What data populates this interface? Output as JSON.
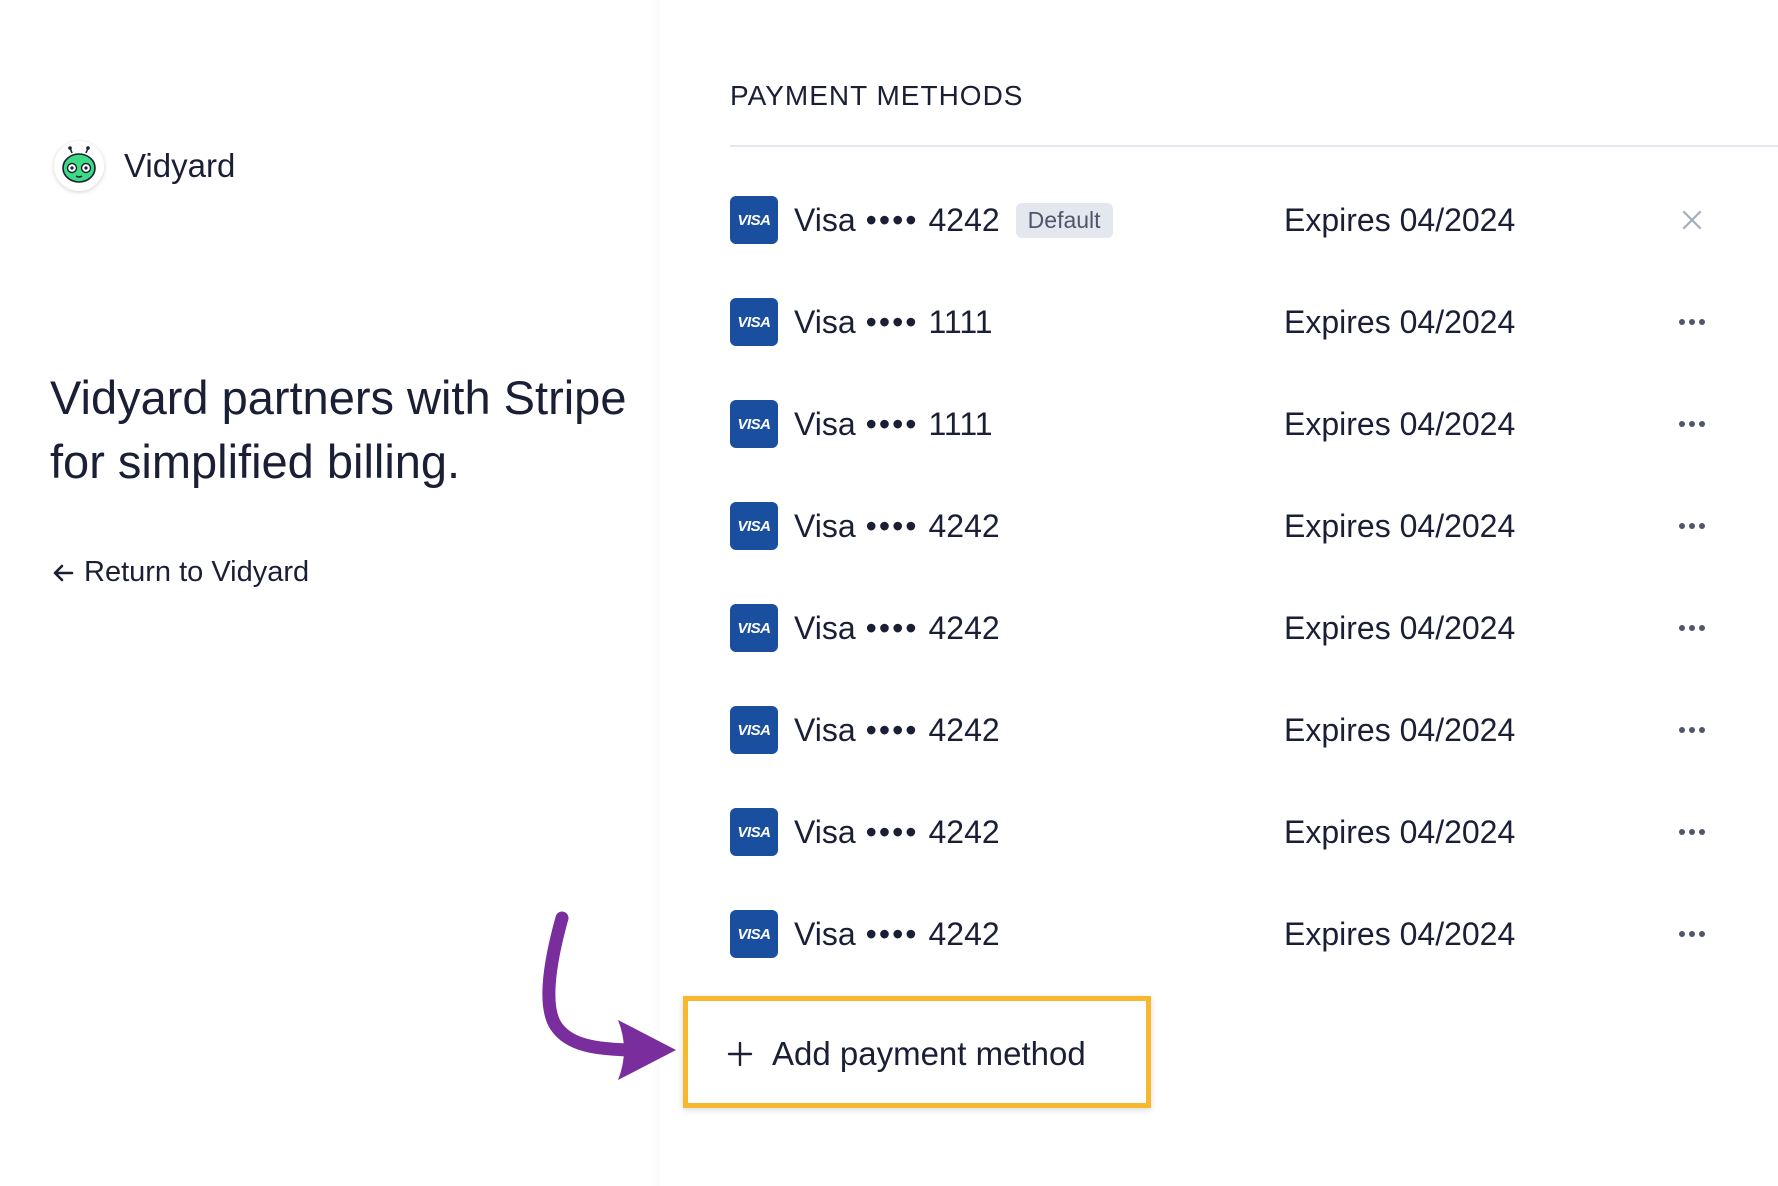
{
  "brand": {
    "name": "Vidyard",
    "logo_icon": "vidyard-robot-icon",
    "accent": "#3ddc84"
  },
  "left": {
    "tagline": "Vidyard partners with Stripe for simplified billing.",
    "return_label": "Return to Vidyard",
    "return_icon": "arrow-left-icon"
  },
  "payment_methods": {
    "title": "PAYMENT METHODS",
    "default_label": "Default",
    "card_badge_text": "VISA",
    "card_badge_color": "#1a4fa0",
    "items": [
      {
        "brand": "Visa",
        "dots": "••••",
        "last4": "4242",
        "expires": "Expires 04/2024",
        "default": true,
        "action_icon": "close-icon"
      },
      {
        "brand": "Visa",
        "dots": "••••",
        "last4": "1111",
        "expires": "Expires 04/2024",
        "default": false,
        "action_icon": "more-horizontal-icon"
      },
      {
        "brand": "Visa",
        "dots": "••••",
        "last4": "1111",
        "expires": "Expires 04/2024",
        "default": false,
        "action_icon": "more-horizontal-icon"
      },
      {
        "brand": "Visa",
        "dots": "••••",
        "last4": "4242",
        "expires": "Expires 04/2024",
        "default": false,
        "action_icon": "more-horizontal-icon"
      },
      {
        "brand": "Visa",
        "dots": "••••",
        "last4": "4242",
        "expires": "Expires 04/2024",
        "default": false,
        "action_icon": "more-horizontal-icon"
      },
      {
        "brand": "Visa",
        "dots": "••••",
        "last4": "4242",
        "expires": "Expires 04/2024",
        "default": false,
        "action_icon": "more-horizontal-icon"
      },
      {
        "brand": "Visa",
        "dots": "••••",
        "last4": "4242",
        "expires": "Expires 04/2024",
        "default": false,
        "action_icon": "more-horizontal-icon"
      },
      {
        "brand": "Visa",
        "dots": "••••",
        "last4": "4242",
        "expires": "Expires 04/2024",
        "default": false,
        "action_icon": "more-horizontal-icon"
      }
    ],
    "add_label": "Add payment method",
    "add_icon": "plus-icon"
  },
  "annotation": {
    "highlight_color": "#f5b82e",
    "arrow_color": "#7a2e9e"
  }
}
